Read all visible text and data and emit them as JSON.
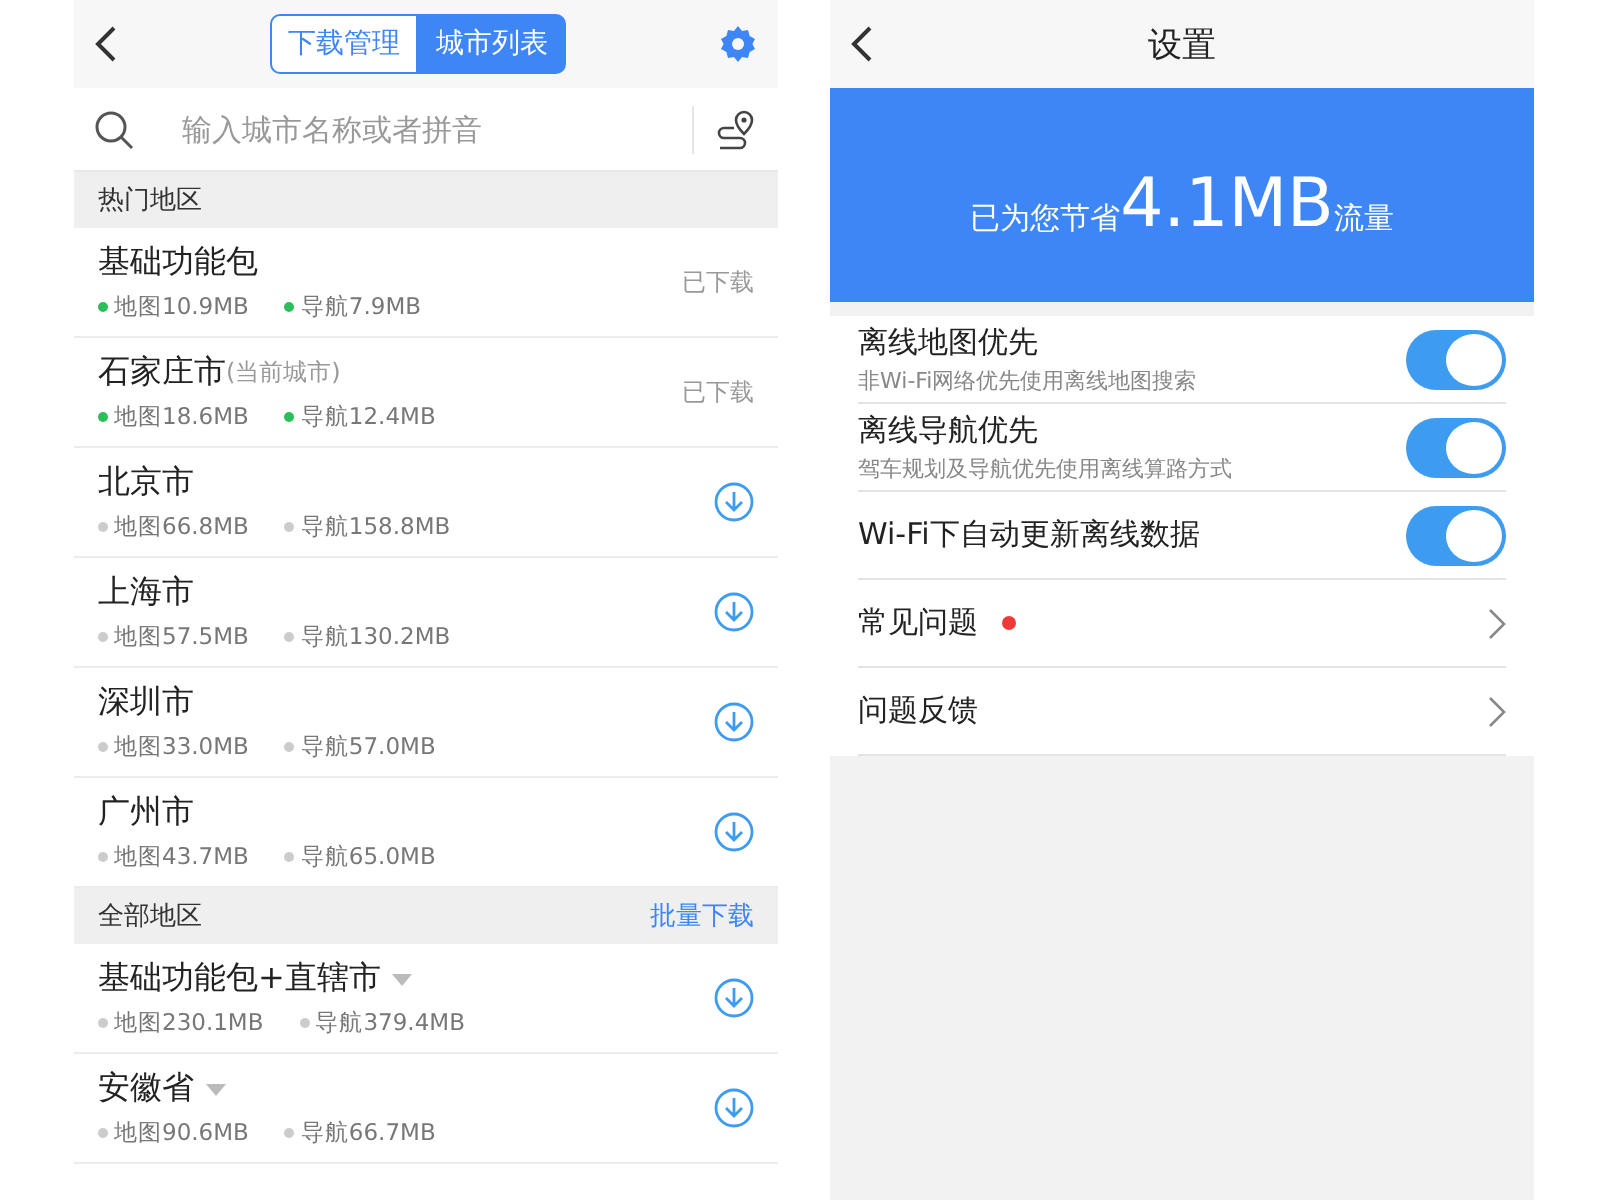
{
  "offline_map": {
    "tabs": [
      {
        "label": "下载管理",
        "selected": false
      },
      {
        "label": "城市列表",
        "selected": true
      }
    ],
    "search": {
      "placeholder": "输入城市名称或者拼音"
    },
    "sections": [
      {
        "title": "热门地区",
        "rows": [
          {
            "name": "基础功能包",
            "note": "",
            "map": "地图10.9MB",
            "nav": "导航7.9MB",
            "downloaded": true,
            "status": "已下载",
            "dropdown": false
          },
          {
            "name": "石家庄市",
            "note": "(当前城市)",
            "map": "地图18.6MB",
            "nav": "导航12.4MB",
            "downloaded": true,
            "status": "已下载",
            "dropdown": false
          },
          {
            "name": "北京市",
            "note": "",
            "map": "地图66.8MB",
            "nav": "导航158.8MB",
            "downloaded": false,
            "dropdown": false
          },
          {
            "name": "上海市",
            "note": "",
            "map": "地图57.5MB",
            "nav": "导航130.2MB",
            "downloaded": false,
            "dropdown": false
          },
          {
            "name": "深圳市",
            "note": "",
            "map": "地图33.0MB",
            "nav": "导航57.0MB",
            "downloaded": false,
            "dropdown": false
          },
          {
            "name": "广州市",
            "note": "",
            "map": "地图43.7MB",
            "nav": "导航65.0MB",
            "downloaded": false,
            "dropdown": false
          }
        ]
      },
      {
        "title": "全部地区",
        "action": "批量下载",
        "rows": [
          {
            "name": "基础功能包+直辖市",
            "note": "",
            "map": "地图230.1MB",
            "nav": "导航379.4MB",
            "downloaded": false,
            "dropdown": true
          },
          {
            "name": "安徽省",
            "note": "",
            "map": "地图90.6MB",
            "nav": "导航66.7MB",
            "downloaded": false,
            "dropdown": true
          }
        ]
      }
    ]
  },
  "settings": {
    "title": "设置",
    "banner": {
      "prefix": "已为您节省",
      "amount": "4.1MB",
      "suffix": "流量"
    },
    "items": [
      {
        "kind": "toggle",
        "label": "离线地图优先",
        "hint": "非Wi-Fi网络优先使用离线地图搜索",
        "on": true
      },
      {
        "kind": "toggle",
        "label": "离线导航优先",
        "hint": "驾车规划及导航优先使用离线算路方式",
        "on": true
      },
      {
        "kind": "toggle",
        "label": "Wi-Fi下自动更新离线数据",
        "on": true
      },
      {
        "kind": "link",
        "label": "常见问题",
        "badge": true
      },
      {
        "kind": "link",
        "label": "问题反馈",
        "badge": false
      }
    ]
  }
}
